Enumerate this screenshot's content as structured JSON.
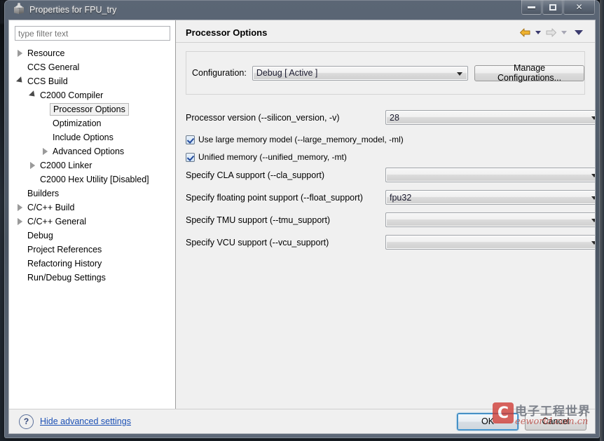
{
  "window": {
    "title": "Properties for FPU_try",
    "icon": "cube-icon",
    "minimize_label": "Minimize",
    "maximize_label": "Maximize",
    "close_label": "Close"
  },
  "filter": {
    "placeholder": "type filter text",
    "value": ""
  },
  "tree": {
    "items": [
      {
        "label": "Resource",
        "indent": 0,
        "twisty": "collapsed",
        "selected": false
      },
      {
        "label": "CCS General",
        "indent": 0,
        "twisty": "none",
        "selected": false
      },
      {
        "label": "CCS Build",
        "indent": 0,
        "twisty": "expanded",
        "selected": false
      },
      {
        "label": "C2000 Compiler",
        "indent": 1,
        "twisty": "expanded",
        "selected": false
      },
      {
        "label": "Processor Options",
        "indent": 2,
        "twisty": "none",
        "selected": true
      },
      {
        "label": "Optimization",
        "indent": 2,
        "twisty": "none",
        "selected": false
      },
      {
        "label": "Include Options",
        "indent": 2,
        "twisty": "none",
        "selected": false
      },
      {
        "label": "Advanced Options",
        "indent": 2,
        "twisty": "collapsed",
        "selected": false
      },
      {
        "label": "C2000 Linker",
        "indent": 1,
        "twisty": "collapsed",
        "selected": false
      },
      {
        "label": "C2000 Hex Utility  [Disabled]",
        "indent": 1,
        "twisty": "none",
        "selected": false
      },
      {
        "label": "Builders",
        "indent": 0,
        "twisty": "none",
        "selected": false
      },
      {
        "label": "C/C++ Build",
        "indent": 0,
        "twisty": "collapsed",
        "selected": false
      },
      {
        "label": "C/C++ General",
        "indent": 0,
        "twisty": "collapsed",
        "selected": false
      },
      {
        "label": "Debug",
        "indent": 0,
        "twisty": "none",
        "selected": false
      },
      {
        "label": "Project References",
        "indent": 0,
        "twisty": "none",
        "selected": false
      },
      {
        "label": "Refactoring History",
        "indent": 0,
        "twisty": "none",
        "selected": false
      },
      {
        "label": "Run/Debug Settings",
        "indent": 0,
        "twisty": "none",
        "selected": false
      }
    ]
  },
  "page": {
    "title": "Processor Options",
    "nav": {
      "back_icon": "back-arrow-icon",
      "back_enabled": true,
      "forward_icon": "forward-arrow-icon",
      "forward_enabled": false,
      "menu_icon": "dropdown-caret-icon"
    }
  },
  "configuration": {
    "label": "Configuration:",
    "value": "Debug  [ Active ]",
    "manage_button": "Manage Configurations..."
  },
  "options": [
    {
      "kind": "combo",
      "label": "Processor version (--silicon_version, -v)",
      "value": "28"
    },
    {
      "kind": "checkbox",
      "label": "Use large memory model (--large_memory_model, -ml)",
      "checked": true
    },
    {
      "kind": "checkbox",
      "label": "Unified memory (--unified_memory, -mt)",
      "checked": true
    },
    {
      "kind": "combo",
      "label": "Specify CLA support (--cla_support)",
      "value": ""
    },
    {
      "kind": "combo",
      "label": "Specify floating point support (--float_support)",
      "value": "fpu32"
    },
    {
      "kind": "combo",
      "label": "Specify TMU support (--tmu_support)",
      "value": ""
    },
    {
      "kind": "combo",
      "label": "Specify VCU support (--vcu_support)",
      "value": ""
    }
  ],
  "footer": {
    "help_icon": "question-mark-icon",
    "advanced_link": "Hide advanced settings",
    "ok_label": "OK",
    "cancel_label": "Cancel"
  },
  "watermark": {
    "logo_glyph": "C",
    "chinese_text": "电子工程世界",
    "domain_text": "eeworld.com.cn"
  },
  "colors": {
    "accent_link": "#1a4fb4",
    "focus_ring": "#52a6e0",
    "back_arrow": "#e8a319",
    "forward_arrow": "#c9c9c9",
    "checkbox_check": "#22499b",
    "watermark_red": "#cf3a33"
  }
}
